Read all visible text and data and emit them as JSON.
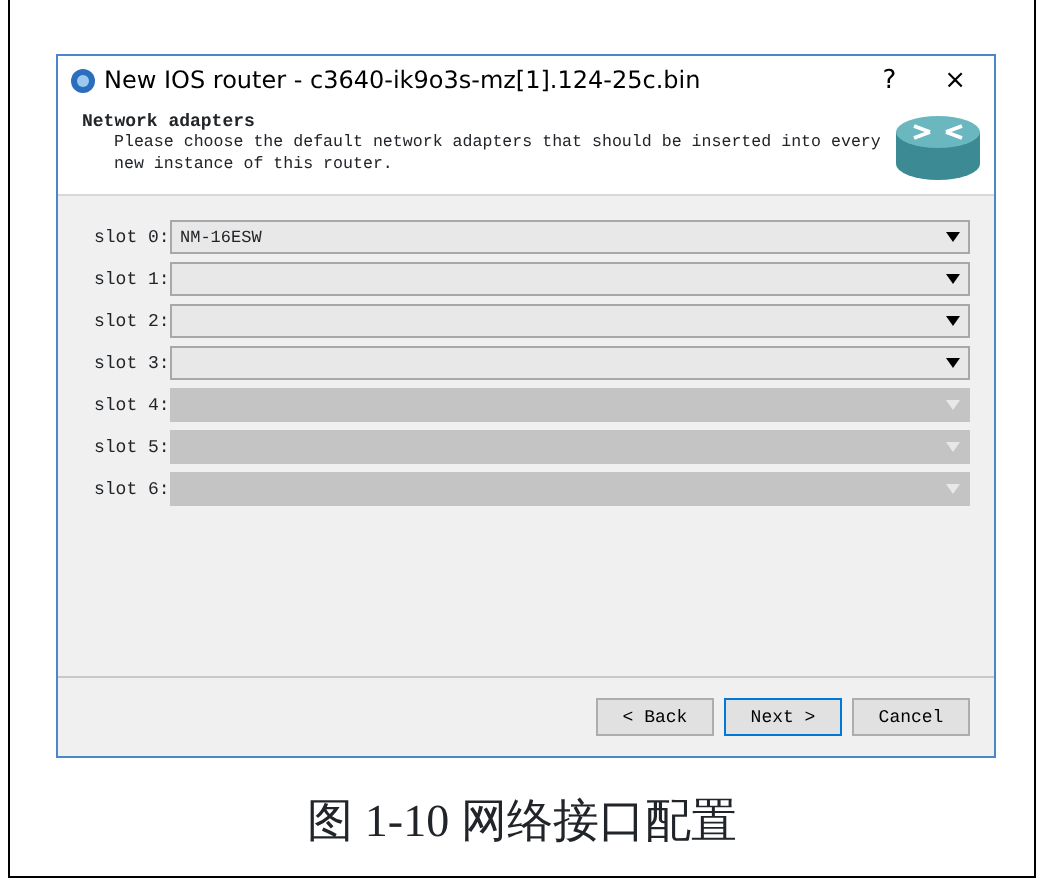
{
  "window": {
    "title": "New IOS router - c3640-ik9o3s-mz[1].124-25c.bin",
    "help": "?",
    "close": "×"
  },
  "header": {
    "title": "Network adapters",
    "description": "Please choose the default network adapters that should be inserted into every new instance of this router."
  },
  "slots": [
    {
      "label": "slot 0:",
      "value": "NM-16ESW",
      "disabled": false
    },
    {
      "label": "slot 1:",
      "disabled": false
    },
    {
      "label": "slot 2:",
      "disabled": false
    },
    {
      "label": "slot 3:",
      "disabled": false
    },
    {
      "label": "slot 4:",
      "disabled": true
    },
    {
      "label": "slot 5:",
      "disabled": true
    },
    {
      "label": "slot 6:",
      "disabled": true
    }
  ],
  "buttons": [
    {
      "label": "< Back",
      "selected": false
    },
    {
      "label": "Next >",
      "selected": true
    },
    {
      "label": "Cancel",
      "selected": false
    }
  ],
  "caption": "图 1-10 网络接口配置"
}
